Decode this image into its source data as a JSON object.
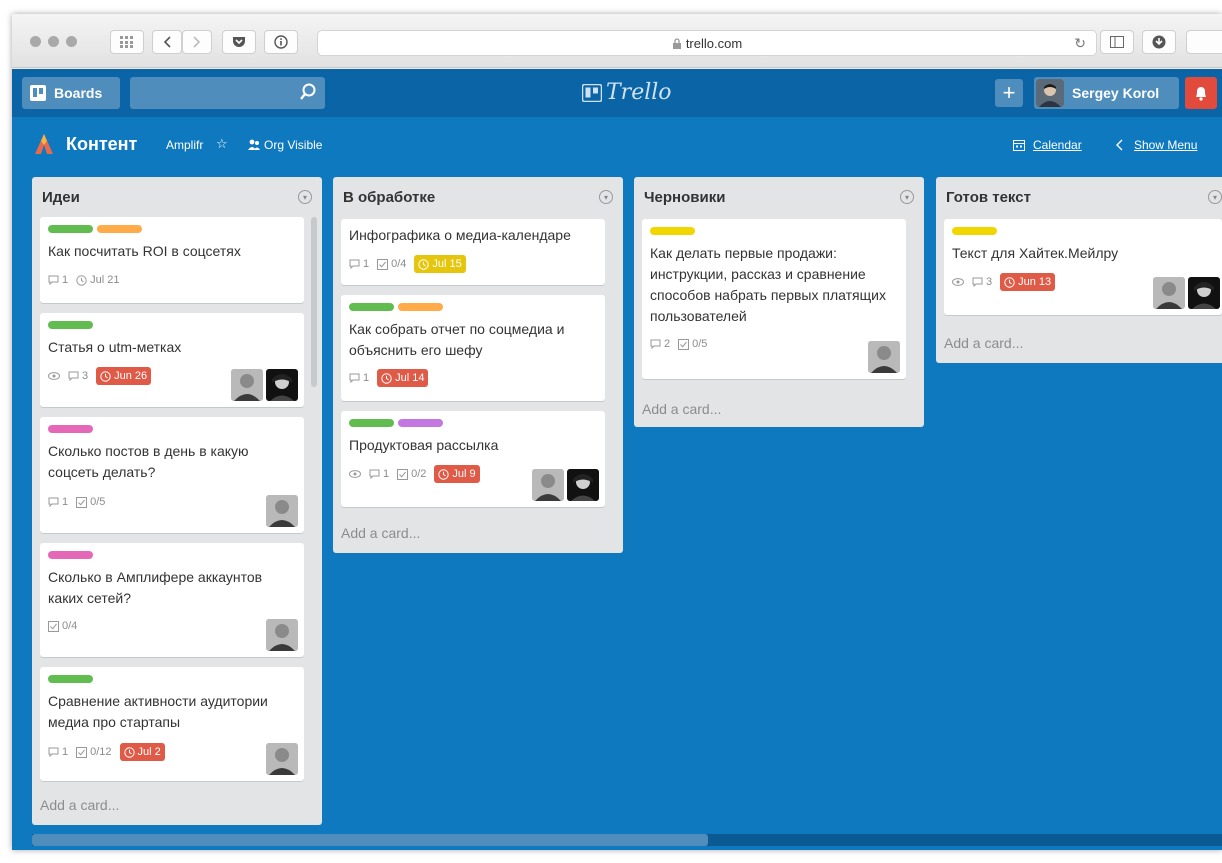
{
  "browser": {
    "url": "trello.com"
  },
  "header": {
    "boards_label": "Boards",
    "logo_text": "Trello",
    "user_name": "Sergey Korol"
  },
  "board": {
    "title": "Контент",
    "team": "Amplifr",
    "visibility": "Org Visible",
    "calendar_label": "Calendar",
    "show_menu_label": "Show Menu"
  },
  "colors": {
    "green": "#61bd4f",
    "orange": "#ffab4a",
    "pink": "#e568b8",
    "purple": "#c377e0",
    "yellow": "#f2d600",
    "red": "#e05a48",
    "due_yellow": "#e6c60d"
  },
  "lists": [
    {
      "title": "Идеи",
      "add_card": "Add a card...",
      "cards": [
        {
          "title": "Как посчитать ROI в соцсетях",
          "comments": "1",
          "date": "Jul 21"
        },
        {
          "title": "Статья о utm-метках",
          "comments": "3",
          "due": "Jun 26"
        },
        {
          "title": "Сколько постов в день в какую соцсеть делать?",
          "comments": "1",
          "checklist": "0/5"
        },
        {
          "title": "Сколько в Амплифере аккаунтов каких сетей?",
          "checklist": "0/4"
        },
        {
          "title": "Сравнение активности аудитории медиа про стартапы",
          "comments": "1",
          "checklist": "0/12",
          "due": "Jul 2"
        }
      ]
    },
    {
      "title": "В обработке",
      "add_card": "Add a card...",
      "cards": [
        {
          "title": "Инфографика о медиа-календаре",
          "comments": "1",
          "checklist": "0/4",
          "due": "Jul 15"
        },
        {
          "title": "Как собрать отчет по соцмедиа и объяснить его шефу",
          "comments": "1",
          "due": "Jul 14"
        },
        {
          "title": "Продуктовая рассылка",
          "comments": "1",
          "checklist": "0/2",
          "due": "Jul 9"
        }
      ]
    },
    {
      "title": "Черновики",
      "add_card": "Add a card...",
      "cards": [
        {
          "title": "Как делать первые продажи: инструкции, рассказ и сравнение способов набрать первых платящих пользователей",
          "comments": "2",
          "checklist": "0/5"
        }
      ]
    },
    {
      "title": "Готов текст",
      "add_card": "Add a card...",
      "cards": [
        {
          "title": "Текст для Хайтек.Мейлру",
          "comments": "3",
          "due": "Jun 13"
        }
      ]
    }
  ]
}
